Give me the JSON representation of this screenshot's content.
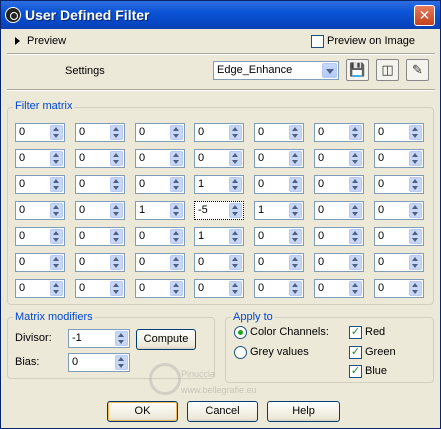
{
  "window": {
    "title": "User Defined Filter",
    "close_glyph": "✕"
  },
  "preview": {
    "toggle_label": "Preview",
    "preview_on_image_label": "Preview on Image",
    "preview_on_image_checked": false
  },
  "settings": {
    "label": "Settings",
    "preset_value": "Edge_Enhance"
  },
  "filter_matrix": {
    "title": "Filter matrix",
    "rows": [
      [
        "0",
        "0",
        "0",
        "0",
        "0",
        "0",
        "0"
      ],
      [
        "0",
        "0",
        "0",
        "0",
        "0",
        "0",
        "0"
      ],
      [
        "0",
        "0",
        "0",
        "1",
        "0",
        "0",
        "0"
      ],
      [
        "0",
        "0",
        "1",
        "-5",
        "1",
        "0",
        "0"
      ],
      [
        "0",
        "0",
        "0",
        "1",
        "0",
        "0",
        "0"
      ],
      [
        "0",
        "0",
        "0",
        "0",
        "0",
        "0",
        "0"
      ],
      [
        "0",
        "0",
        "0",
        "0",
        "0",
        "0",
        "0"
      ]
    ]
  },
  "matrix_modifiers": {
    "title": "Matrix modifiers",
    "divisor_label": "Divisor:",
    "divisor_value": "-1",
    "compute_label": "Compute",
    "bias_label": "Bias:",
    "bias_value": "0"
  },
  "apply_to": {
    "title": "Apply to",
    "color_channels_label": "Color Channels:",
    "grey_values_label": "Grey values",
    "selected": "color_channels",
    "red_label": "Red",
    "green_label": "Green",
    "blue_label": "Blue",
    "red_checked": true,
    "green_checked": true,
    "blue_checked": true
  },
  "buttons": {
    "ok": "OK",
    "cancel": "Cancel",
    "help": "Help"
  },
  "watermark": {
    "text": "Pinuccia",
    "url": "www.bellegrafie.eu"
  },
  "icons": {
    "save": "save-preset-icon",
    "delete": "delete-preset-icon",
    "edit": "edit-preset-icon"
  }
}
